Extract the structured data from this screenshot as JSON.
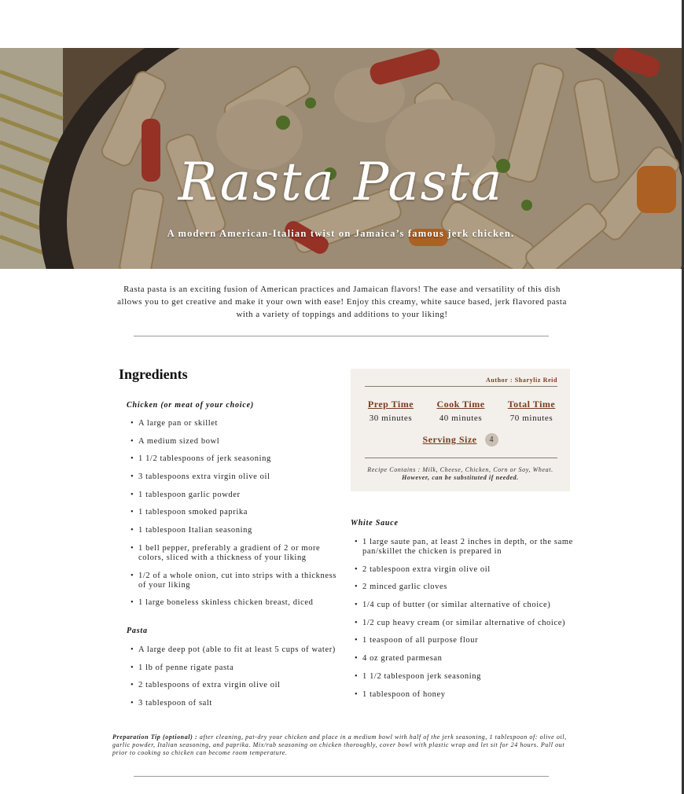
{
  "hero": {
    "title": "Rasta Pasta",
    "subtitle": "A modern American-Italian twist on Jamaica’s famous jerk chicken."
  },
  "intro": "Rasta pasta is an exciting fusion of American practices and Jamaican flavors! The ease and versatility of this dish allows you to get creative and make it your own with ease! Enjoy this creamy, white sauce based, jerk flavored pasta with a variety of toppings and additions to your liking!",
  "ingredients": {
    "heading": "Ingredients",
    "chicken": {
      "title": "Chicken (or meat of your choice)",
      "items": [
        "A large pan or skillet",
        "A medium sized bowl",
        "1 1/2 tablespoons of jerk seasoning",
        "3 tablespoons extra virgin olive oil",
        "1 tablespoon garlic powder",
        "1 tablespoon smoked paprika",
        "1 tablespoon Italian seasoning",
        "1 bell pepper, preferably a gradient of 2 or more colors, sliced with a thickness of your liking",
        "1/2 of a whole onion, cut into strips with a thickness of your liking",
        "1 large boneless skinless chicken breast, diced"
      ]
    },
    "pasta": {
      "title": "Pasta",
      "items": [
        "A large deep pot (able to fit at least 5 cups of water)",
        "1 lb of penne rigate pasta",
        "2 tablespoons of extra virgin olive oil",
        "3 tablespoon of salt"
      ]
    },
    "sauce": {
      "title": "White Sauce",
      "items": [
        "1 large saute pan, at least 2 inches in depth, or the same pan/skillet the chicken is prepared in",
        "2 tablespoon extra virgin olive oil",
        "2 minced garlic cloves",
        "1/4 cup of butter (or similar alternative of choice)",
        "1/2 cup heavy cream (or similar alternative of choice)",
        "1 teaspoon of all purpose flour",
        "4 oz grated parmesan",
        "1 1/2 tablespoon jerk seasoning",
        "1 tablespoon of honey"
      ]
    }
  },
  "card": {
    "author": "Author : Sharyliz Reid",
    "prep_label": "Prep Time",
    "prep_value": "30 minutes",
    "cook_label": "Cook Time",
    "cook_value": "40 minutes",
    "total_label": "Total Time",
    "total_value": "70 minutes",
    "serving_label": "Serving Size",
    "serving_value": "4",
    "contains_text": "Recipe Contains : Milk, Cheese, Chicken, Corn or Soy, Wheat.",
    "contains_note": "However, can be substituted if needed."
  },
  "tip": {
    "label": "Preparation Tip (optional) :",
    "text": "after cleaning, pat-dry your chicken and place in a medium bowl with half of the jerk seasoning, 1 tablespoon of: olive oil, garlic powder, Italian seasoning, and paprika. Mix/rub seasoning on chicken thoroughly, cover bowl with plastic wrap and let sit for 24 hours. Pull out prior to cooking so chicken can become room temperature."
  },
  "colors": {
    "accent": "#7a3b1e",
    "card_bg": "#f3f0eb"
  }
}
